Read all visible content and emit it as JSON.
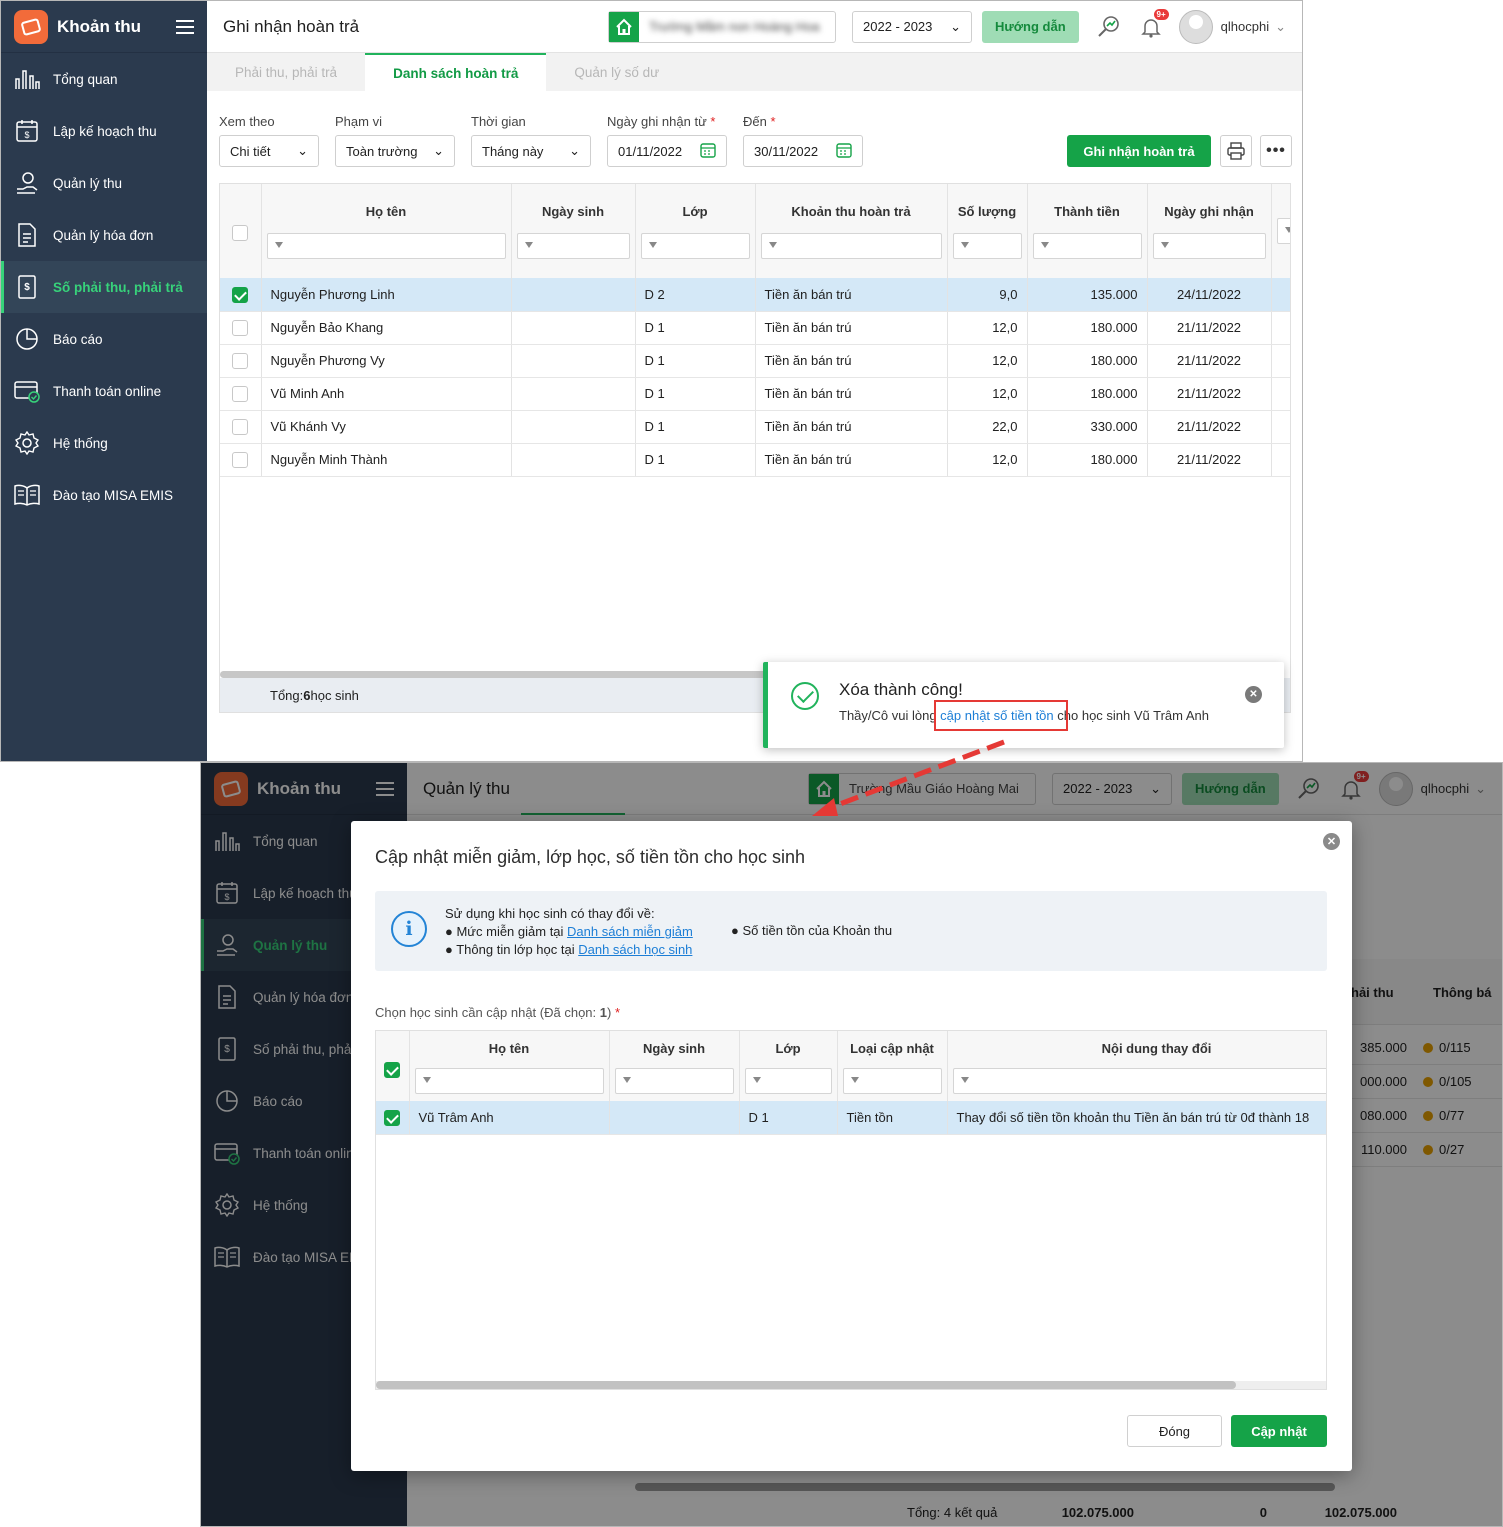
{
  "app": {
    "name": "Khoản thu"
  },
  "sidebar": {
    "items": [
      {
        "label": "Tổng quan",
        "icon": "bar-chart-icon"
      },
      {
        "label": "Lập kế hoạch thu",
        "icon": "calendar-money-icon"
      },
      {
        "label": "Quản lý thu",
        "icon": "hand-coin-icon"
      },
      {
        "label": "Quản lý hóa đơn",
        "icon": "invoice-icon"
      },
      {
        "label": "Số phải thu, phải trả",
        "icon": "ledger-icon"
      },
      {
        "label": "Báo cáo",
        "icon": "pie-chart-icon"
      },
      {
        "label": "Thanh toán online",
        "icon": "online-payment-icon"
      },
      {
        "label": "Hệ thống",
        "icon": "gear-icon"
      },
      {
        "label": "Đào tạo MISA EMIS",
        "icon": "book-icon"
      }
    ]
  },
  "header": {
    "year": "2022 - 2023",
    "guide": "Hướng dẫn",
    "notif_badge": "9+",
    "user": "qlhocphi",
    "school_s2": "Trường Mầu Giáo Hoàng Mai"
  },
  "screen1": {
    "title": "Ghi nhận hoàn trả",
    "tabs": [
      "Phải thu, phải trả",
      "Danh sách hoàn trả",
      "Quản lý số dư"
    ],
    "filters": {
      "xem_theo": {
        "label": "Xem theo",
        "value": "Chi tiết"
      },
      "pham_vi": {
        "label": "Phạm vi",
        "value": "Toàn trường"
      },
      "thoi_gian": {
        "label": "Thời gian",
        "value": "Tháng này"
      },
      "tu": {
        "label": "Ngày ghi nhận từ",
        "value": "01/11/2022"
      },
      "den": {
        "label": "Đến",
        "value": "30/11/2022"
      },
      "required": "*"
    },
    "action_button": "Ghi nhận hoàn trả",
    "columns": [
      "Họ tên",
      "Ngày sinh",
      "Lớp",
      "Khoản thu hoàn trả",
      "Số lượng",
      "Thành tiền",
      "Ngày ghi nhận"
    ],
    "rows": [
      {
        "name": "Nguyễn Phương Linh",
        "dob": "",
        "class": "D 2",
        "item": "Tiền ăn bán trú",
        "qty": "9,0",
        "amount": "135.000",
        "date": "24/11/2022",
        "checked": true
      },
      {
        "name": "Nguyễn Bảo Khang",
        "dob": "",
        "class": "D 1",
        "item": "Tiền ăn bán trú",
        "qty": "12,0",
        "amount": "180.000",
        "date": "21/11/2022",
        "checked": false
      },
      {
        "name": "Nguyễn Phương Vy",
        "dob": "",
        "class": "D 1",
        "item": "Tiền ăn bán trú",
        "qty": "12,0",
        "amount": "180.000",
        "date": "21/11/2022",
        "checked": false
      },
      {
        "name": "Vũ Minh Anh",
        "dob": "",
        "class": "D 1",
        "item": "Tiền ăn bán trú",
        "qty": "12,0",
        "amount": "180.000",
        "date": "21/11/2022",
        "checked": false
      },
      {
        "name": "Vũ Khánh Vy",
        "dob": "",
        "class": "D 1",
        "item": "Tiền ăn bán trú",
        "qty": "22,0",
        "amount": "330.000",
        "date": "21/11/2022",
        "checked": false
      },
      {
        "name": "Nguyễn Minh Thành",
        "dob": "",
        "class": "D 1",
        "item": "Tiền ăn bán trú",
        "qty": "12,0",
        "amount": "180.000",
        "date": "21/11/2022",
        "checked": false
      }
    ],
    "footer": {
      "prefix": "Tổng: ",
      "count": "6",
      "suffix": " học sinh"
    },
    "toast": {
      "title": "Xóa thành công!",
      "msg_before": "Thầy/Cô vui lòng ",
      "link": "cập nhật số tiền tồn",
      "msg_after": " cho học sinh Vũ Trâm Anh"
    }
  },
  "screen2": {
    "title": "Quản lý thu",
    "bg_columns": [
      "hải thu",
      "Thông bá"
    ],
    "bg_rows": [
      {
        "amount": "385.000",
        "notice": "0/115"
      },
      {
        "amount": "000.000",
        "notice": "0/105"
      },
      {
        "amount": "080.000",
        "notice": "0/77"
      },
      {
        "amount": "110.000",
        "notice": "0/27"
      }
    ],
    "bg_footer": {
      "label": "Tổng: 4 kết quả",
      "v1": "102.075.000",
      "v2": "0",
      "v3": "102.075.000"
    },
    "modal": {
      "title": "Cập nhật miễn giảm, lớp học, số tiền tồn cho học sinh",
      "info_heading": "Sử dụng khi học sinh có thay đổi về:",
      "info_line1_text": "Mức miễn giảm tại ",
      "info_line1_link": "Danh sách miễn giảm",
      "info_line2_text": "Thông tin lớp học tại ",
      "info_line2_link": "Danh sách học sinh",
      "info_line3": "Số tiền tồn của Khoản thu",
      "select_label": "Chọn học sinh cần cập nhật (Đã chọn: ",
      "selected_count": "1",
      "select_label_end": ")",
      "required": "*",
      "columns": [
        "Họ tên",
        "Ngày sinh",
        "Lớp",
        "Loại cập nhật",
        "Nội dung thay đổi"
      ],
      "rows": [
        {
          "name": "Vũ Trâm Anh",
          "dob": "",
          "class": "D 1",
          "type": "Tiền tồn",
          "change": "Thay đổi số tiền tồn khoản thu Tiền ăn bán trú từ 0đ thành 18"
        }
      ],
      "close_button": "Đóng",
      "update_button": "Cập nhật"
    }
  }
}
